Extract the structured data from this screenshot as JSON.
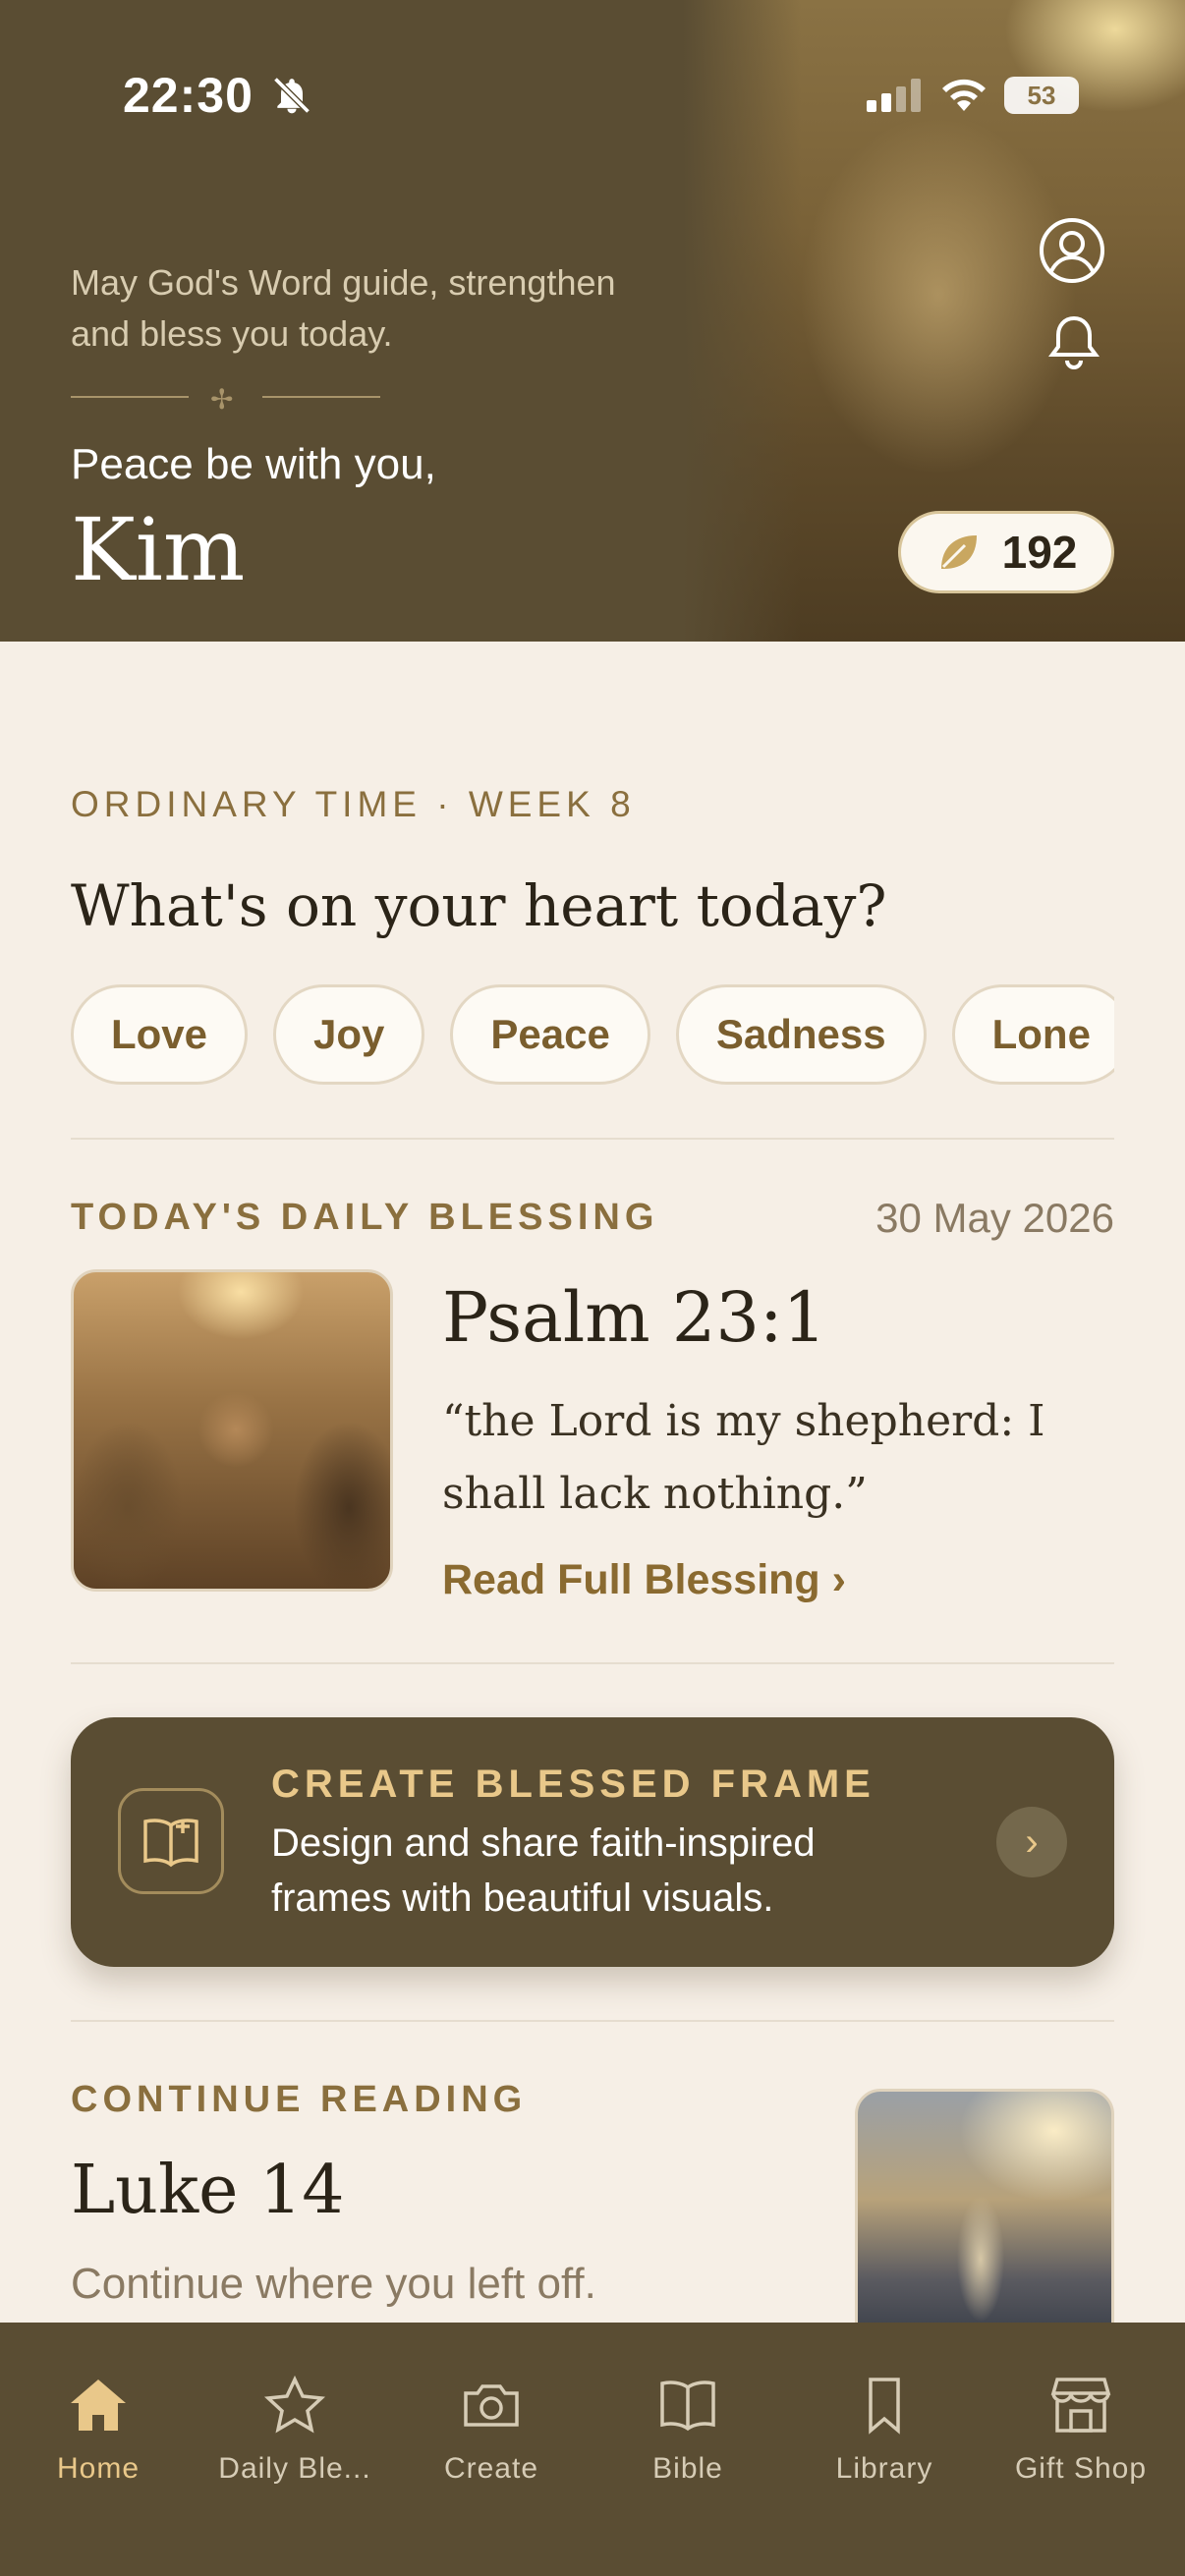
{
  "status_bar": {
    "time": "22:30",
    "battery": "53"
  },
  "header": {
    "tagline": "May God's Word guide, strengthen and bless you today.",
    "greeting": "Peace be with you,",
    "name": "Kim",
    "points": "192"
  },
  "season": "ORDINARY TIME · WEEK 8",
  "heart": {
    "question": "What's on your heart today?",
    "chips": [
      "Love",
      "Joy",
      "Peace",
      "Sadness",
      "Lone"
    ]
  },
  "blessing": {
    "label": "TODAY'S DAILY BLESSING",
    "date": "30 May 2026",
    "reference": "Psalm 23:1",
    "text": "“the Lord is my shepherd: I shall lack nothing.”",
    "link": "Read Full Blessing  ›"
  },
  "frame_card": {
    "title": "CREATE BLESSED FRAME",
    "description": "Design and share faith-inspired frames with beautiful visuals."
  },
  "continue_reading": {
    "label": "CONTINUE READING",
    "book": "Luke 14",
    "subtitle": "Continue where you left off."
  },
  "nav": {
    "items": [
      {
        "label": "Home",
        "icon": "home-icon",
        "active": true
      },
      {
        "label": "Daily Ble...",
        "icon": "star-icon",
        "active": false
      },
      {
        "label": "Create",
        "icon": "camera-icon",
        "active": false
      },
      {
        "label": "Bible",
        "icon": "book-icon",
        "active": false
      },
      {
        "label": "Library",
        "icon": "bookmark-icon",
        "active": false
      },
      {
        "label": "Gift Shop",
        "icon": "store-icon",
        "active": false
      }
    ]
  },
  "colors": {
    "header_bg": "#5a4d33",
    "accent_gold": "#e9c88a",
    "page_bg": "#f6efe6",
    "label_brown": "#8a6f3e"
  }
}
